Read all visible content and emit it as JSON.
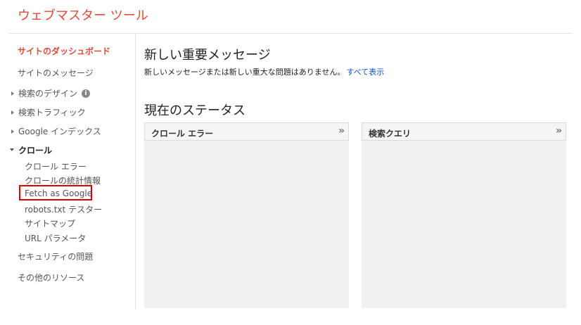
{
  "app": {
    "title": "ウェブマスター ツール"
  },
  "sidebar": {
    "dashboard": "サイトのダッシュボード",
    "messages": "サイトのメッセージ",
    "search_appearance": "検索のデザイン",
    "search_traffic": "検索トラフィック",
    "google_index": "Google インデックス",
    "crawl": {
      "label": "クロール",
      "items": [
        "クロール エラー",
        "クロールの統計情報",
        "Fetch as Google",
        "robots.txt テスター",
        "サイトマップ",
        "URL パラメータ"
      ]
    },
    "security": "セキュリティの問題",
    "other_resources": "その他のリソース"
  },
  "main": {
    "messages_heading": "新しい重要メッセージ",
    "messages_text": "新しいメッセージまたは新しい重大な問題はありません。",
    "show_all_link": "すべて表示",
    "status_heading": "現在のステータス",
    "cards": [
      {
        "title": "クロール エラー"
      },
      {
        "title": "検索クエリ"
      }
    ]
  },
  "icons": {
    "info": "i",
    "expand": "»"
  },
  "colors": {
    "accent": "#dd4b39",
    "link": "#1155cc",
    "highlight": "#e00000"
  }
}
